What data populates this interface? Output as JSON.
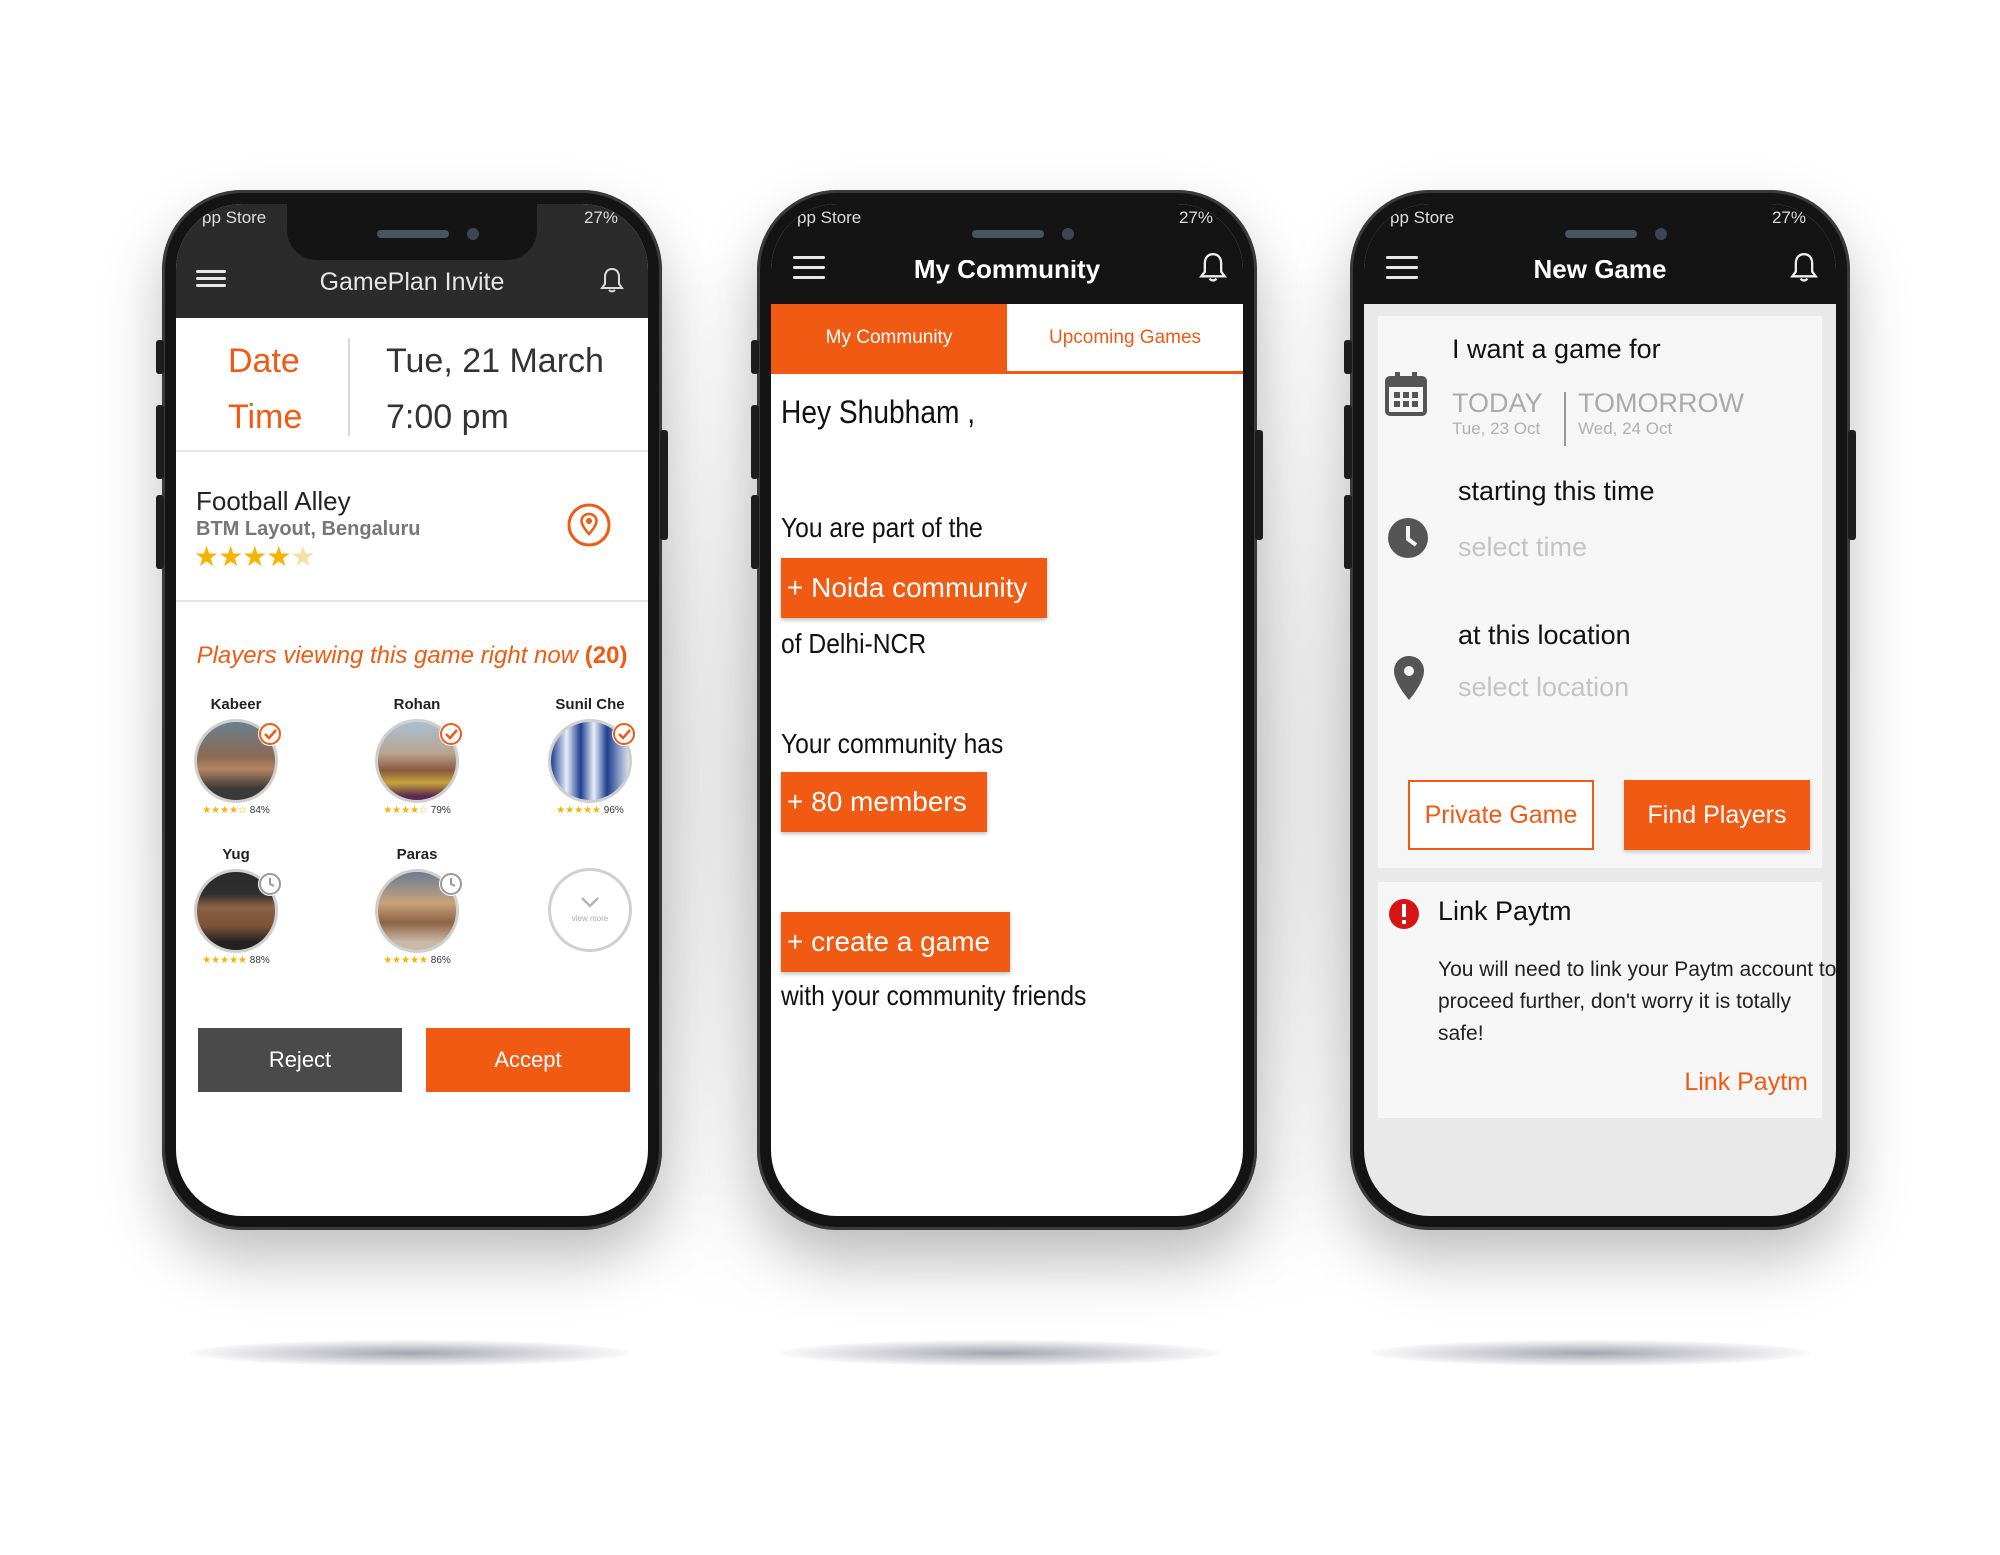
{
  "colors": {
    "accent": "#f15a12",
    "dark_bar": "#141414",
    "secondary_button": "#4a4a4a"
  },
  "invite_screen": {
    "status_left": "pp Store",
    "status_right": "27%",
    "title": "GamePlan Invite",
    "date_label": "Date",
    "date_value": "Tue, 21 March",
    "time_label": "Time",
    "time_value": "7:00 pm",
    "venue_name": "Football Alley",
    "venue_location": "BTM Layout, Bengaluru",
    "venue_rating": 4,
    "players_heading": "Players viewing this game right now",
    "players_count": "(20)",
    "players": [
      {
        "name": "Kabeer",
        "percent": "84%",
        "stars": 4,
        "status": "confirmed"
      },
      {
        "name": "Rohan",
        "percent": "79%",
        "stars": 4,
        "status": "confirmed"
      },
      {
        "name": "Sunil Che",
        "percent": "96%",
        "stars": 5,
        "status": "confirmed"
      },
      {
        "name": "Yug",
        "percent": "88%",
        "stars": 5,
        "status": "pending"
      },
      {
        "name": "Paras",
        "percent": "86%",
        "stars": 5,
        "status": "pending"
      }
    ],
    "view_more": "view more",
    "reject_label": "Reject",
    "accept_label": "Accept"
  },
  "community_screen": {
    "status_left": "pp Store",
    "status_right": "27%",
    "title": "My Community",
    "tab_active": "My Community",
    "tab_inactive": "Upcoming Games",
    "greeting": "Hey Shubham ,",
    "part_of": "You are part of the",
    "community_button": "+ Noida community",
    "region": "of Delhi-NCR",
    "has_text": "Your community has",
    "members_button": "+ 80 members",
    "create_button": "+ create a game",
    "friends_text": "with your community friends"
  },
  "new_game_screen": {
    "status_left": "pp Store",
    "status_right": "27%",
    "title": "New Game",
    "want_label": "I want a game for",
    "today_label": "TODAY",
    "today_date": "Tue, 23 Oct",
    "tomorrow_label": "TOMORROW",
    "tomorrow_date": "Wed, 24 Oct",
    "time_label": "starting this time",
    "time_placeholder": "select time",
    "location_label": "at this location",
    "location_placeholder": "select location",
    "private_button": "Private Game",
    "find_button": "Find Players",
    "paytm_title": "Link Paytm",
    "paytm_message_1": "You will need to link your Paytm account to",
    "paytm_message_2": "proceed further, don't worry it is totally",
    "paytm_message_3": "safe!",
    "paytm_link": "Link Paytm"
  }
}
